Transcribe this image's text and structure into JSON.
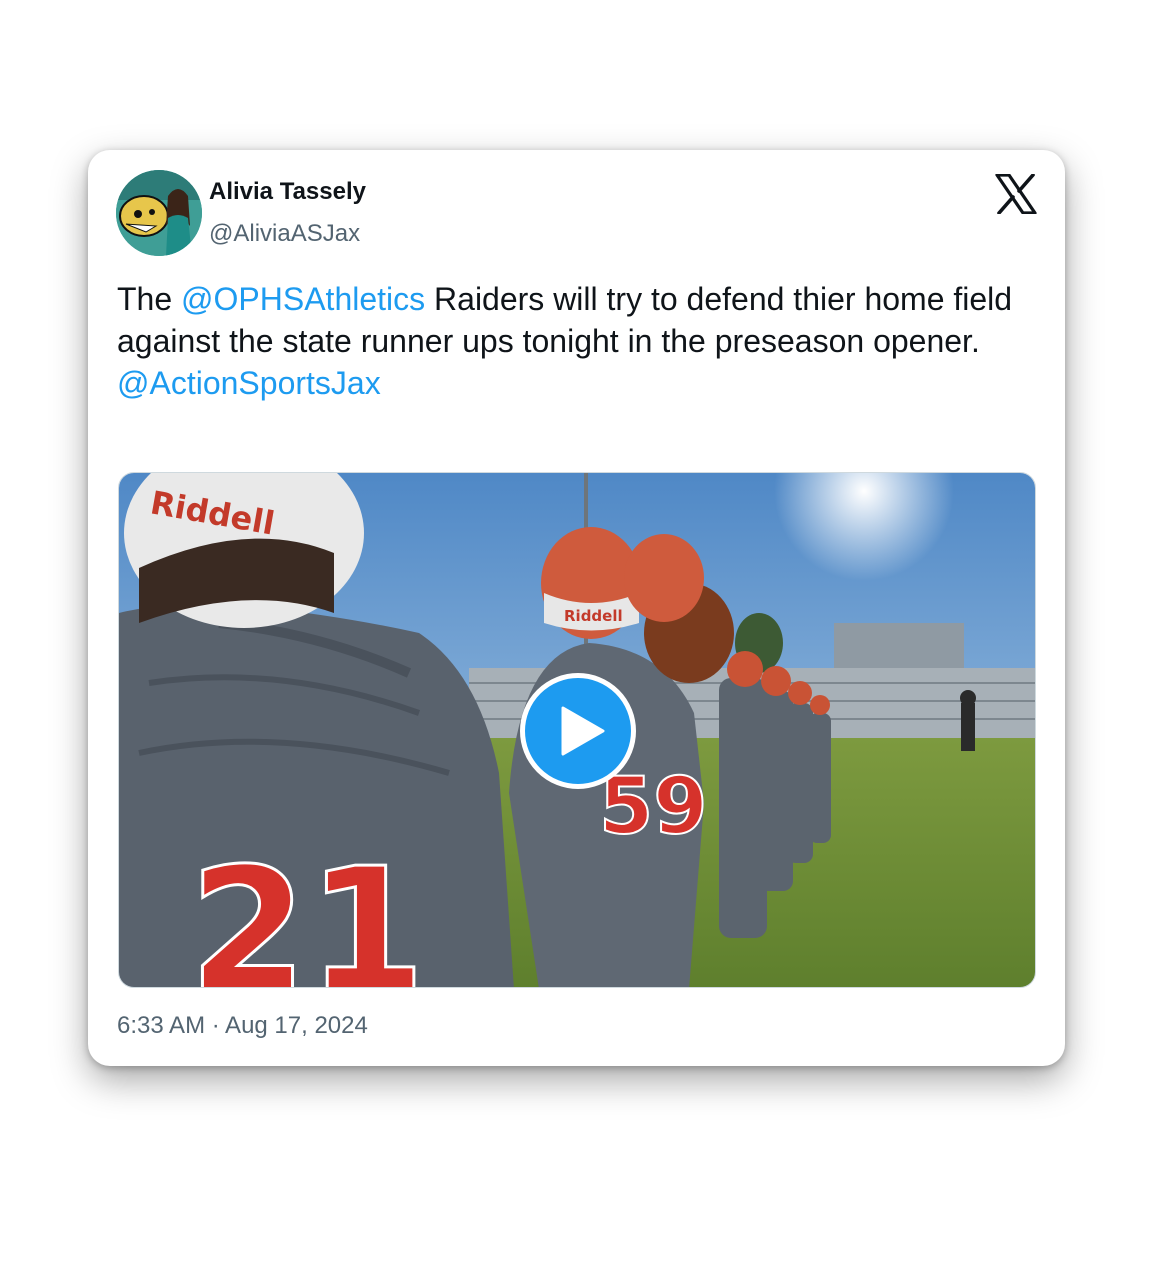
{
  "author": {
    "name": "Alivia Tassely",
    "handle": "@AliviaASJax"
  },
  "tweet": {
    "text_before": "The ",
    "mention_1": "@OPHSAthletics",
    "text_after": " Raiders will try to defend thier home field against the state runner ups tonight in the preseason opener.",
    "mention_2": "@ActionSportsJax"
  },
  "media": {
    "type": "video",
    "helmet_brand": "Riddell",
    "jersey_numbers": [
      "21",
      "59"
    ]
  },
  "timestamp": "6:33 AM · Aug 17, 2024",
  "icons": {
    "brand": "x-logo-icon",
    "play": "play-icon"
  },
  "colors": {
    "link": "#1d9bf0",
    "text": "#0f1419",
    "secondary": "#536471",
    "jersey": "#5a6470",
    "jersey_number": "#d6322b"
  }
}
